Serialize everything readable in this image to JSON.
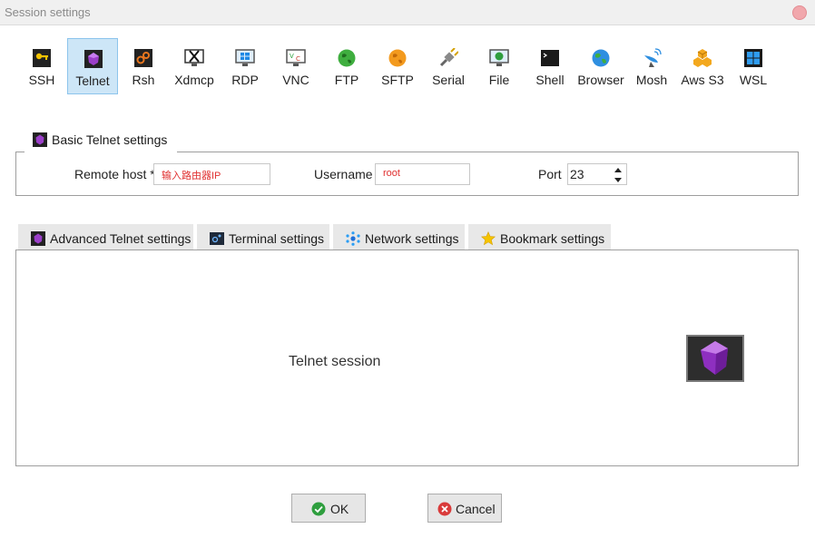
{
  "window": {
    "title": "Session settings"
  },
  "protocols": [
    {
      "label": "SSH",
      "icon": "key-icon"
    },
    {
      "label": "Telnet",
      "icon": "telnet-gem-icon",
      "selected": true
    },
    {
      "label": "Rsh",
      "icon": "gears-icon"
    },
    {
      "label": "Xdmcp",
      "icon": "x-monitor-icon"
    },
    {
      "label": "RDP",
      "icon": "windows-monitor-icon"
    },
    {
      "label": "VNC",
      "icon": "vnc-monitor-icon"
    },
    {
      "label": "FTP",
      "icon": "green-globe-icon"
    },
    {
      "label": "SFTP",
      "icon": "orange-globe-icon"
    },
    {
      "label": "Serial",
      "icon": "serial-plug-icon"
    },
    {
      "label": "File",
      "icon": "file-globe-monitor-icon"
    },
    {
      "label": "Shell",
      "icon": "terminal-icon"
    },
    {
      "label": "Browser",
      "icon": "globe-icon"
    },
    {
      "label": "Mosh",
      "icon": "satellite-dish-icon"
    },
    {
      "label": "Aws S3",
      "icon": "aws-cubes-icon"
    },
    {
      "label": "WSL",
      "icon": "windows-logo-icon"
    }
  ],
  "basic": {
    "tab_label": "Basic Telnet settings",
    "remote_host_label": "Remote host *",
    "remote_host_value": "输入路由器IP",
    "username_label": "Username",
    "username_value": "root",
    "port_label": "Port",
    "port_value": "23"
  },
  "tabs": [
    {
      "label": "Advanced Telnet settings",
      "icon": "telnet-gem-icon"
    },
    {
      "label": "Terminal settings",
      "icon": "terminal-settings-icon"
    },
    {
      "label": "Network settings",
      "icon": "network-icon"
    },
    {
      "label": "Bookmark settings",
      "icon": "star-icon"
    }
  ],
  "panel": {
    "session_text": "Telnet session",
    "icon": "telnet-gem-icon"
  },
  "buttons": {
    "ok_label": "OK",
    "cancel_label": "Cancel"
  },
  "colors": {
    "accent": "#cde6f7",
    "ok_green": "#2e9e3e",
    "cancel_red": "#d93b3b",
    "input_text": "#e03030"
  }
}
